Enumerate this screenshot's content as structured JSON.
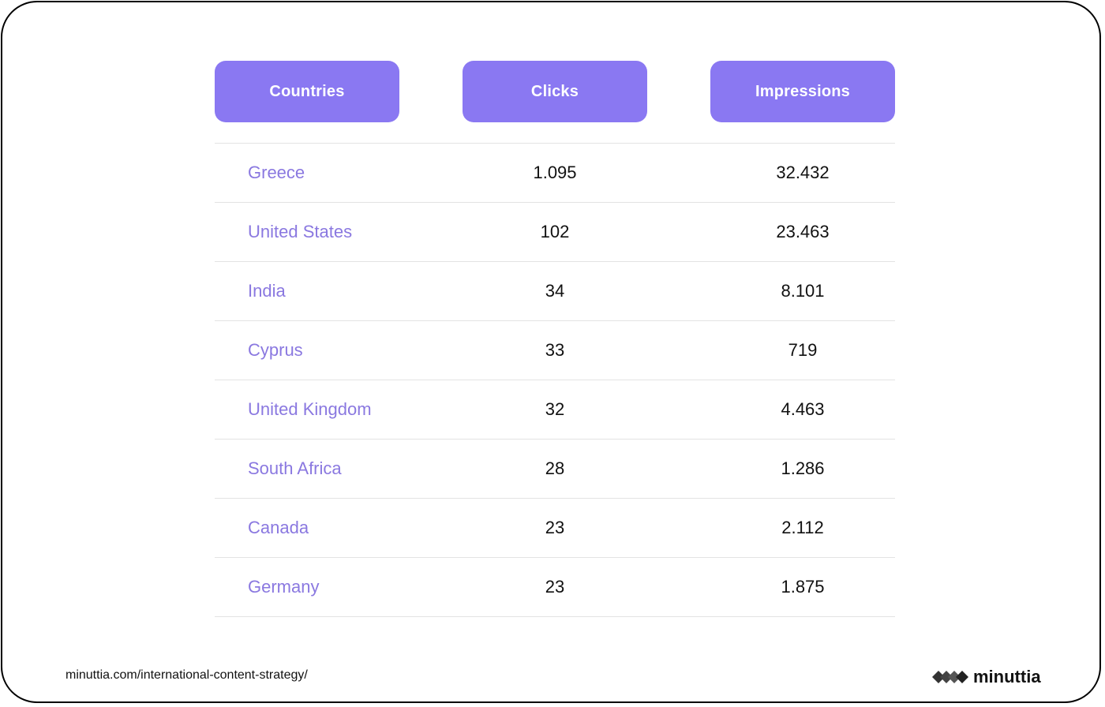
{
  "chart_data": {
    "type": "table",
    "columns": [
      "Countries",
      "Clicks",
      "Impressions"
    ],
    "rows": [
      {
        "country": "Greece",
        "clicks": "1.095",
        "impressions": "32.432"
      },
      {
        "country": "United States",
        "clicks": "102",
        "impressions": "23.463"
      },
      {
        "country": "India",
        "clicks": "34",
        "impressions": "8.101"
      },
      {
        "country": "Cyprus",
        "clicks": "33",
        "impressions": "719"
      },
      {
        "country": "United Kingdom",
        "clicks": "32",
        "impressions": "4.463"
      },
      {
        "country": "South Africa",
        "clicks": "28",
        "impressions": "1.286"
      },
      {
        "country": "Canada",
        "clicks": "23",
        "impressions": "2.112"
      },
      {
        "country": "Germany",
        "clicks": "23",
        "impressions": "1.875"
      }
    ]
  },
  "footer": {
    "url": "minuttia.com/international-content-strategy/",
    "brand": "minuttia"
  },
  "colors": {
    "header_bg": "#8a78f2",
    "country_text": "#8a78e0"
  }
}
